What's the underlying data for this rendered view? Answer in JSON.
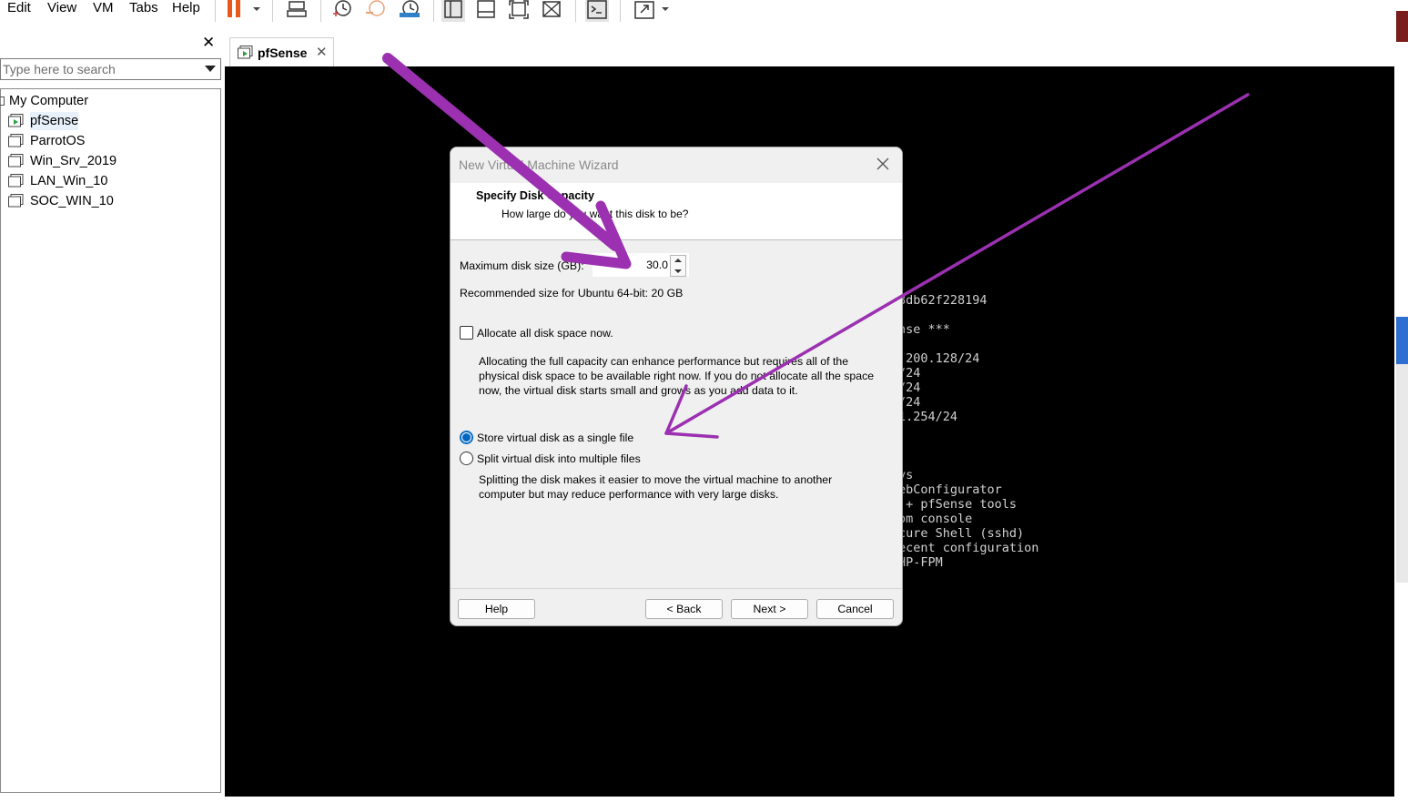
{
  "menu": {
    "items": [
      "Edit",
      "View",
      "VM",
      "Tabs",
      "Help"
    ]
  },
  "library": {
    "close": "✕",
    "search_placeholder": "Type here to search",
    "root": "My Computer",
    "vms": [
      "pfSense",
      "ParrotOS",
      "Win_Srv_2019",
      "LAN_Win_10",
      "SOC_WIN_10"
    ]
  },
  "tab": {
    "label": "pfSense",
    "close": "✕"
  },
  "console": {
    "lines": [
      "8db62f228194",
      "nse ***",
      ".200.128/24",
      "/24",
      "/24",
      "/24",
      "1.254/24",
      "",
      "",
      "ys",
      "ebConfigurator",
      " + pfSense tools",
      "om console",
      "cure Shell (sshd)",
      "ecent configuration",
      "HP-FPM"
    ]
  },
  "dialog": {
    "title": "New Virtual Machine Wizard",
    "heading": "Specify Disk Capacity",
    "subheading": "How large do you want this disk to be?",
    "max_disk_label": "Maximum disk size (GB):",
    "max_disk_value": "30.0",
    "recommended": "Recommended size for Ubuntu 64-bit: 20 GB",
    "allocate_label": "Allocate all disk space now.",
    "allocate_desc": "Allocating the full capacity can enhance performance but requires all of the physical disk space to be available right now. If you do not allocate all the space now, the virtual disk starts small and grows as you add data to it.",
    "single_file_label": "Store virtual disk as a single file",
    "multi_file_label": "Split virtual disk into multiple files",
    "split_desc": "Splitting the disk makes it easier to move the virtual machine to another computer but may reduce performance with very large disks.",
    "buttons": {
      "help": "Help",
      "back": "< Back",
      "next": "Next >",
      "cancel": "Cancel"
    }
  },
  "colors": {
    "accent": "#0067c0",
    "annotation": "#9b30b0",
    "pause": "#e8581c"
  }
}
